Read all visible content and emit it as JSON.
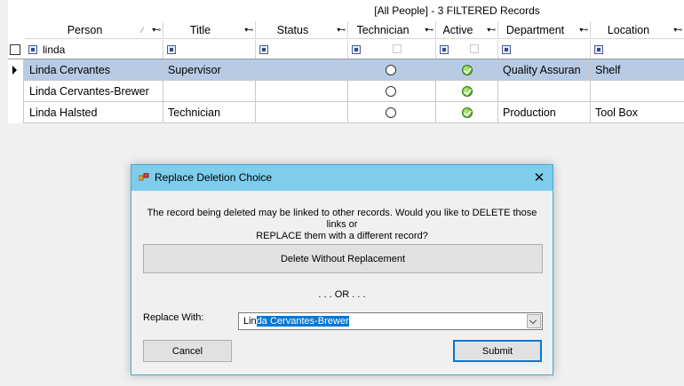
{
  "grid": {
    "caption": "[All People] - 3 FILTERED Records",
    "columns": [
      {
        "key": "person",
        "label": "Person"
      },
      {
        "key": "title",
        "label": "Title"
      },
      {
        "key": "status",
        "label": "Status"
      },
      {
        "key": "technician",
        "label": "Technician"
      },
      {
        "key": "active",
        "label": "Active"
      },
      {
        "key": "department",
        "label": "Department"
      },
      {
        "key": "location",
        "label": "Location"
      }
    ],
    "filter": {
      "person": "linda"
    },
    "rows": [
      {
        "person": "Linda Cervantes",
        "title": "Supervisor",
        "status": "",
        "technician": false,
        "active": true,
        "department": "Quality Assuran",
        "location": "Shelf",
        "selected": true
      },
      {
        "person": "Linda Cervantes-Brewer",
        "title": "",
        "status": "",
        "technician": false,
        "active": true,
        "department": "",
        "location": "",
        "selected": false
      },
      {
        "person": "Linda Halsted",
        "title": "Technician",
        "status": "",
        "technician": false,
        "active": true,
        "department": "Production",
        "location": "Tool Box",
        "selected": false
      }
    ]
  },
  "dialog": {
    "title": "Replace Deletion Choice",
    "message_line1": "The record being deleted may be linked to other records.  Would you like to DELETE those links or",
    "message_line2": "REPLACE them with a different record?",
    "delete_button": "Delete Without Replacement",
    "or_text": ". . . OR . . .",
    "replace_label": "Replace With:",
    "replace_typed": "Lin",
    "replace_suggested": "da Cervantes-Brewer",
    "cancel_button": "Cancel",
    "submit_button": "Submit"
  },
  "icons": {
    "sort": "pencil-sort-icon",
    "filter": "filter-pin-icon",
    "active_ok": "green-check-icon",
    "close": "close-icon"
  },
  "colors": {
    "selected_row": "#b8cbe4",
    "dialog_title": "#7dcdeb",
    "highlight": "#0078d7"
  }
}
